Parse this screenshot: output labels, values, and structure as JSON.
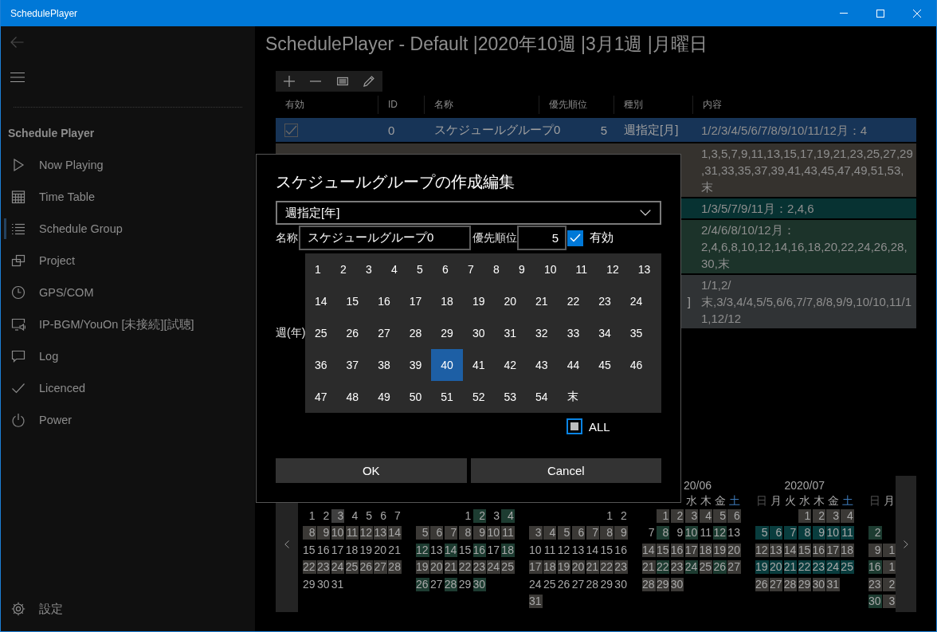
{
  "window": {
    "title": "SchedulePlayer"
  },
  "sidebar": {
    "heading": "Schedule Player",
    "items": [
      {
        "label": "Now Playing",
        "selected": false
      },
      {
        "label": "Time Table",
        "selected": false
      },
      {
        "label": "Schedule Group",
        "selected": true
      },
      {
        "label": "Project",
        "selected": false
      },
      {
        "label": "GPS/COM",
        "selected": false
      },
      {
        "label": "IP-BGM/YouOn [未接続][試聴]",
        "selected": false
      },
      {
        "label": "Log",
        "selected": false
      },
      {
        "label": "Licenced",
        "selected": false
      },
      {
        "label": "Power",
        "selected": false
      }
    ],
    "footer": {
      "label": "設定"
    }
  },
  "page": {
    "title": "SchedulePlayer - Default |2020年10週 |3月1週 |月曜日"
  },
  "table": {
    "columns": [
      "有効",
      "ID",
      "名称",
      "優先順位",
      "種別",
      "内容"
    ],
    "rows": [
      {
        "selected": true,
        "enabled": true,
        "id": "0",
        "name": "スケジュールグループ0",
        "priority": "5",
        "type": "週指定[月]",
        "content": "1/2/3/4/5/6/7/8/9/10/11/12月：4"
      },
      {
        "selected": false,
        "color": "#35322e",
        "content": "1,3,5,7,9,11,13,15,17,19,21,23,25,27,29,31,33,35,37,39,41,43,45,47,49,51,53,末"
      },
      {
        "selected": false,
        "color": "#073232",
        "content": "1/3/5/7/9/11月：2,4,6"
      },
      {
        "selected": false,
        "color": "#1c332a",
        "content": "2/4/6/8/10/12月：2,4,6,8,10,12,14,16,18,20,22,24,26,28,30,末"
      },
      {
        "selected": false,
        "color": "#303335",
        "type": "]",
        "content": "1/1,2/末,3/3,4/4,5/5,6/6,7/7,8/8,9/9,10/10,11/11,12/12"
      }
    ]
  },
  "calendars": [
    {
      "weeks": [
        {
          "kind": "first",
          "days": [
            {
              "day": "1"
            },
            {
              "day": "2"
            },
            {
              "day": "3",
              "color": "#3f3f3f"
            },
            {
              "day": "4"
            },
            {
              "day": "5"
            },
            {
              "day": "6"
            },
            {
              "day": "7"
            }
          ]
        },
        {
          "kind": "week",
          "days": [
            {
              "day": "8",
              "color": "#3b3936"
            },
            {
              "day": "9",
              "color": "#3b3936"
            },
            {
              "day": "10",
              "color": "#3b3936"
            },
            {
              "day": "11",
              "color": "#3b3936"
            },
            {
              "day": "12",
              "color": "#3b3936"
            },
            {
              "day": "13",
              "color": "#3b3936"
            },
            {
              "day": "14",
              "color": "#3b3936"
            }
          ]
        },
        {
          "kind": "week",
          "days": [
            {
              "day": "15"
            },
            {
              "day": "16"
            },
            {
              "day": "17"
            },
            {
              "day": "18"
            },
            {
              "day": "19"
            },
            {
              "day": "20"
            },
            {
              "day": "21"
            }
          ]
        },
        {
          "kind": "week",
          "days": [
            {
              "day": "22",
              "color": "#3b3936"
            },
            {
              "day": "23",
              "color": "#3b3936"
            },
            {
              "day": "24",
              "color": "#3b3936"
            },
            {
              "day": "25",
              "color": "#3b3936"
            },
            {
              "day": "26",
              "color": "#3b3936"
            },
            {
              "day": "27",
              "color": "#3b3936"
            },
            {
              "day": "28",
              "color": "#3b3936"
            }
          ]
        },
        {
          "kind": "week",
          "days": [
            {
              "day": "29"
            },
            {
              "day": "30"
            },
            {
              "day": "31"
            }
          ]
        }
      ]
    },
    {
      "weeks": [
        {
          "kind": "first",
          "days": [
            {
              "day": "1"
            },
            {
              "day": "2",
              "color": "#1d3c31"
            },
            {
              "day": "3"
            },
            {
              "day": "4",
              "color": "#1d3c31"
            }
          ]
        },
        {
          "kind": "week",
          "days": [
            {
              "day": "5",
              "color": "#3b3936"
            },
            {
              "day": "6",
              "color": "#3b3936"
            },
            {
              "day": "7",
              "color": "#3b3936"
            },
            {
              "day": "8",
              "color": "#3b3936"
            },
            {
              "day": "9",
              "color": "#3b3936"
            },
            {
              "day": "10",
              "color": "#3b3936"
            },
            {
              "day": "11",
              "color": "#3b3936"
            }
          ]
        },
        {
          "kind": "week",
          "days": [
            {
              "day": "12",
              "color": "#1d3c31"
            },
            {
              "day": "13"
            },
            {
              "day": "14",
              "color": "#1d3c31"
            },
            {
              "day": "15"
            },
            {
              "day": "16",
              "color": "#1d3c31"
            },
            {
              "day": "17"
            },
            {
              "day": "18",
              "color": "#1d3c31"
            }
          ]
        },
        {
          "kind": "week",
          "days": [
            {
              "day": "19",
              "color": "#3b3936"
            },
            {
              "day": "20",
              "color": "#3b3936"
            },
            {
              "day": "21",
              "color": "#3b3936"
            },
            {
              "day": "22",
              "color": "#3b3936"
            },
            {
              "day": "23",
              "color": "#3b3936"
            },
            {
              "day": "24",
              "color": "#3b3936"
            },
            {
              "day": "25",
              "color": "#3b3936"
            }
          ]
        },
        {
          "kind": "week",
          "days": [
            {
              "day": "26",
              "color": "#1d3c31"
            },
            {
              "day": "27"
            },
            {
              "day": "28",
              "color": "#1d3c31"
            },
            {
              "day": "29"
            },
            {
              "day": "30",
              "color": "#1d3c31"
            }
          ]
        }
      ]
    },
    {
      "weeks": [
        {
          "kind": "first",
          "days": [
            {
              "day": "1"
            },
            {
              "day": "2"
            }
          ]
        },
        {
          "kind": "week",
          "days": [
            {
              "day": "3",
              "color": "#3b3936"
            },
            {
              "day": "4",
              "color": "#3b3936"
            },
            {
              "day": "5",
              "color": "#3b3936"
            },
            {
              "day": "6",
              "color": "#3b3936"
            },
            {
              "day": "7",
              "color": "#3b3936"
            },
            {
              "day": "8",
              "color": "#3b3936"
            },
            {
              "day": "9",
              "color": "#3b3936"
            }
          ]
        },
        {
          "kind": "week",
          "days": [
            {
              "day": "10"
            },
            {
              "day": "11"
            },
            {
              "day": "12"
            },
            {
              "day": "13"
            },
            {
              "day": "14"
            },
            {
              "day": "15"
            },
            {
              "day": "16"
            }
          ]
        },
        {
          "kind": "week",
          "days": [
            {
              "day": "17",
              "color": "#3b3936"
            },
            {
              "day": "18",
              "color": "#3b3936"
            },
            {
              "day": "19",
              "color": "#3b3936"
            },
            {
              "day": "20",
              "color": "#3b3936"
            },
            {
              "day": "21",
              "color": "#3b3936"
            },
            {
              "day": "22",
              "color": "#3b3936"
            },
            {
              "day": "23",
              "color": "#3b3936"
            }
          ]
        },
        {
          "kind": "week",
          "days": [
            {
              "day": "24"
            },
            {
              "day": "25"
            },
            {
              "day": "26"
            },
            {
              "day": "27"
            },
            {
              "day": "28"
            },
            {
              "day": "29"
            },
            {
              "day": "30"
            }
          ]
        },
        {
          "kind": "week",
          "days": [
            {
              "day": "31",
              "color": "#3b3936"
            }
          ]
        }
      ]
    },
    {
      "title": "20/06",
      "weekdays": [
        {
          "label": "水",
          "kind": "wed"
        },
        {
          "label": "木",
          "kind": "thu"
        },
        {
          "label": "金",
          "kind": "fri"
        },
        {
          "label": "土",
          "kind": "sat",
          "color": "#3d7ab8"
        }
      ],
      "weeks": [
        {
          "kind": "first",
          "days": [
            {
              "day": "1",
              "color": "#3b3936"
            },
            {
              "day": "2",
              "color": "#3b3936"
            },
            {
              "day": "3",
              "color": "#3b3936"
            },
            {
              "day": "4",
              "color": "#3b3936"
            },
            {
              "day": "5",
              "color": "#3b3936"
            },
            {
              "day": "6",
              "color": "#3b3936"
            }
          ]
        },
        {
          "kind": "week",
          "days": [
            {
              "day": "7"
            },
            {
              "day": "8",
              "color": "#1d3c31"
            },
            {
              "day": "9"
            },
            {
              "day": "10",
              "color": "#1d3c31"
            },
            {
              "day": "11"
            },
            {
              "day": "12",
              "color": "#1d3c31"
            },
            {
              "day": "13"
            }
          ]
        },
        {
          "kind": "week",
          "days": [
            {
              "day": "14",
              "color": "#3b3936"
            },
            {
              "day": "15",
              "color": "#3b3936"
            },
            {
              "day": "16",
              "color": "#3b3936"
            },
            {
              "day": "17",
              "color": "#3b3936"
            },
            {
              "day": "18",
              "color": "#3b3936"
            },
            {
              "day": "19",
              "color": "#3b3936"
            },
            {
              "day": "20",
              "color": "#3b3936"
            }
          ]
        },
        {
          "kind": "week",
          "days": [
            {
              "day": "21",
              "color": "#3b3936"
            },
            {
              "day": "22",
              "color": "#1d3c31"
            },
            {
              "day": "23",
              "color": "#3b3936"
            },
            {
              "day": "24",
              "color": "#1d3c31"
            },
            {
              "day": "25",
              "color": "#3b3936"
            },
            {
              "day": "26",
              "color": "#1d3c31"
            },
            {
              "day": "27",
              "color": "#3b3936"
            }
          ]
        },
        {
          "kind": "week",
          "days": [
            {
              "day": "28",
              "color": "#3b3936"
            },
            {
              "day": "29",
              "color": "#3b3936"
            },
            {
              "day": "30",
              "color": "#3b3936"
            }
          ]
        }
      ]
    },
    {
      "title": "2020/07",
      "weekdays": [
        {
          "label": "日",
          "kind": "sun",
          "color": "#505050"
        },
        {
          "label": "月",
          "kind": "mon"
        },
        {
          "label": "火",
          "kind": "tue"
        },
        {
          "label": "水",
          "kind": "wed"
        },
        {
          "label": "木",
          "kind": "thu"
        },
        {
          "label": "金",
          "kind": "fri"
        },
        {
          "label": "土",
          "kind": "sat",
          "color": "#3d7ab8"
        }
      ],
      "weeks": [
        {
          "kind": "first",
          "days": [
            {
              "day": "1",
              "color": "#3b3936"
            },
            {
              "day": "2",
              "color": "#3b3936"
            },
            {
              "day": "3",
              "color": "#3b3936"
            },
            {
              "day": "4",
              "color": "#3b3936"
            }
          ]
        },
        {
          "kind": "week",
          "days": [
            {
              "day": "5",
              "color": "#093d3e"
            },
            {
              "day": "6",
              "color": "#093d3e"
            },
            {
              "day": "7",
              "color": "#093d3e"
            },
            {
              "day": "8",
              "color": "#093d3e"
            },
            {
              "day": "9",
              "color": "#093d3e"
            },
            {
              "day": "10",
              "color": "#093d3e"
            },
            {
              "day": "11",
              "color": "#093d3e"
            }
          ]
        },
        {
          "kind": "week",
          "days": [
            {
              "day": "12",
              "color": "#3b3936"
            },
            {
              "day": "13",
              "color": "#3b3936"
            },
            {
              "day": "14",
              "color": "#3b3936"
            },
            {
              "day": "15",
              "color": "#3b3936"
            },
            {
              "day": "16",
              "color": "#3b3936"
            },
            {
              "day": "17",
              "color": "#3b3936"
            },
            {
              "day": "18",
              "color": "#3b3936"
            }
          ]
        },
        {
          "kind": "week",
          "days": [
            {
              "day": "19",
              "color": "#093d3e"
            },
            {
              "day": "20",
              "color": "#093d3e"
            },
            {
              "day": "21",
              "color": "#093d3e"
            },
            {
              "day": "22",
              "color": "#093d3e"
            },
            {
              "day": "23",
              "color": "#093d3e"
            },
            {
              "day": "24",
              "color": "#093d3e"
            },
            {
              "day": "25",
              "color": "#093d3e"
            }
          ]
        },
        {
          "kind": "week",
          "days": [
            {
              "day": "26",
              "color": "#3b3936"
            },
            {
              "day": "27",
              "color": "#3b3936"
            },
            {
              "day": "28",
              "color": "#3b3936"
            },
            {
              "day": "29",
              "color": "#3b3936"
            },
            {
              "day": "30",
              "color": "#3b3936"
            },
            {
              "day": "31",
              "color": "#3b3936"
            }
          ]
        }
      ]
    },
    {
      "weekdays": [
        {
          "label": "日",
          "kind": "sun",
          "color": "#505050"
        },
        {
          "label": "月",
          "kind": "mon"
        }
      ],
      "weeks": [
        {
          "kind": "blank"
        },
        {
          "kind": "week",
          "days": [
            {
              "day": "2",
              "color": "#1d3c31"
            }
          ]
        },
        {
          "kind": "week",
          "days": [
            {
              "day": "9",
              "color": "#3b3936"
            },
            {
              "day": "1",
              "color": "#3b3936"
            }
          ]
        },
        {
          "kind": "week",
          "days": [
            {
              "day": "16",
              "color": "#1d3c31"
            },
            {
              "day": "1",
              "color": "#3b3936"
            }
          ]
        },
        {
          "kind": "week",
          "days": [
            {
              "day": "23",
              "color": "#3b3936"
            },
            {
              "day": "2",
              "color": "#3b3936"
            }
          ]
        },
        {
          "kind": "week",
          "days": [
            {
              "day": "30",
              "color": "#1d3c31"
            },
            {
              "day": "3",
              "color": "#3b3936"
            }
          ]
        }
      ]
    }
  ],
  "dialog": {
    "title": "スケジュールグループの作成編集",
    "type_select": {
      "value": "週指定[年]"
    },
    "name": {
      "label": "名称",
      "value": "スケジュールグループ0"
    },
    "priority": {
      "label": "優先順位",
      "value": "5"
    },
    "enabled": {
      "label": "有効",
      "checked": true
    },
    "weeks": {
      "label": "週(年)",
      "items": [
        {
          "label": "1",
          "selected": false
        },
        {
          "label": "2",
          "selected": false
        },
        {
          "label": "3",
          "selected": false
        },
        {
          "label": "4",
          "selected": false
        },
        {
          "label": "5",
          "selected": false
        },
        {
          "label": "6",
          "selected": false
        },
        {
          "label": "7",
          "selected": false
        },
        {
          "label": "8",
          "selected": false
        },
        {
          "label": "9",
          "selected": false
        },
        {
          "label": "10",
          "selected": false
        },
        {
          "label": "11",
          "selected": false
        },
        {
          "label": "12",
          "selected": false
        },
        {
          "label": "13",
          "selected": false
        },
        {
          "label": "14",
          "selected": false
        },
        {
          "label": "15",
          "selected": false
        },
        {
          "label": "16",
          "selected": false
        },
        {
          "label": "17",
          "selected": false
        },
        {
          "label": "18",
          "selected": false
        },
        {
          "label": "19",
          "selected": false
        },
        {
          "label": "20",
          "selected": false
        },
        {
          "label": "21",
          "selected": false
        },
        {
          "label": "22",
          "selected": false
        },
        {
          "label": "23",
          "selected": false
        },
        {
          "label": "24",
          "selected": false
        },
        {
          "label": "25",
          "selected": false
        },
        {
          "label": "26",
          "selected": false
        },
        {
          "label": "27",
          "selected": false
        },
        {
          "label": "28",
          "selected": false
        },
        {
          "label": "29",
          "selected": false
        },
        {
          "label": "30",
          "selected": false
        },
        {
          "label": "31",
          "selected": false
        },
        {
          "label": "32",
          "selected": false
        },
        {
          "label": "33",
          "selected": false
        },
        {
          "label": "34",
          "selected": false
        },
        {
          "label": "35",
          "selected": false
        },
        {
          "label": "36",
          "selected": false
        },
        {
          "label": "37",
          "selected": false
        },
        {
          "label": "38",
          "selected": false
        },
        {
          "label": "39",
          "selected": false
        },
        {
          "label": "40",
          "selected": true
        },
        {
          "label": "41",
          "selected": false
        },
        {
          "label": "42",
          "selected": false
        },
        {
          "label": "43",
          "selected": false
        },
        {
          "label": "44",
          "selected": false
        },
        {
          "label": "45",
          "selected": false
        },
        {
          "label": "46",
          "selected": false
        },
        {
          "label": "47",
          "selected": false
        },
        {
          "label": "48",
          "selected": false
        },
        {
          "label": "49",
          "selected": false
        },
        {
          "label": "50",
          "selected": false
        },
        {
          "label": "51",
          "selected": false
        },
        {
          "label": "52",
          "selected": false
        },
        {
          "label": "53",
          "selected": false
        },
        {
          "label": "54",
          "selected": false
        },
        {
          "label": "末",
          "selected": false
        }
      ]
    },
    "all": {
      "label": "ALL",
      "checked": false,
      "indeterminate": true
    },
    "buttons": [
      "OK",
      "Cancel"
    ]
  }
}
